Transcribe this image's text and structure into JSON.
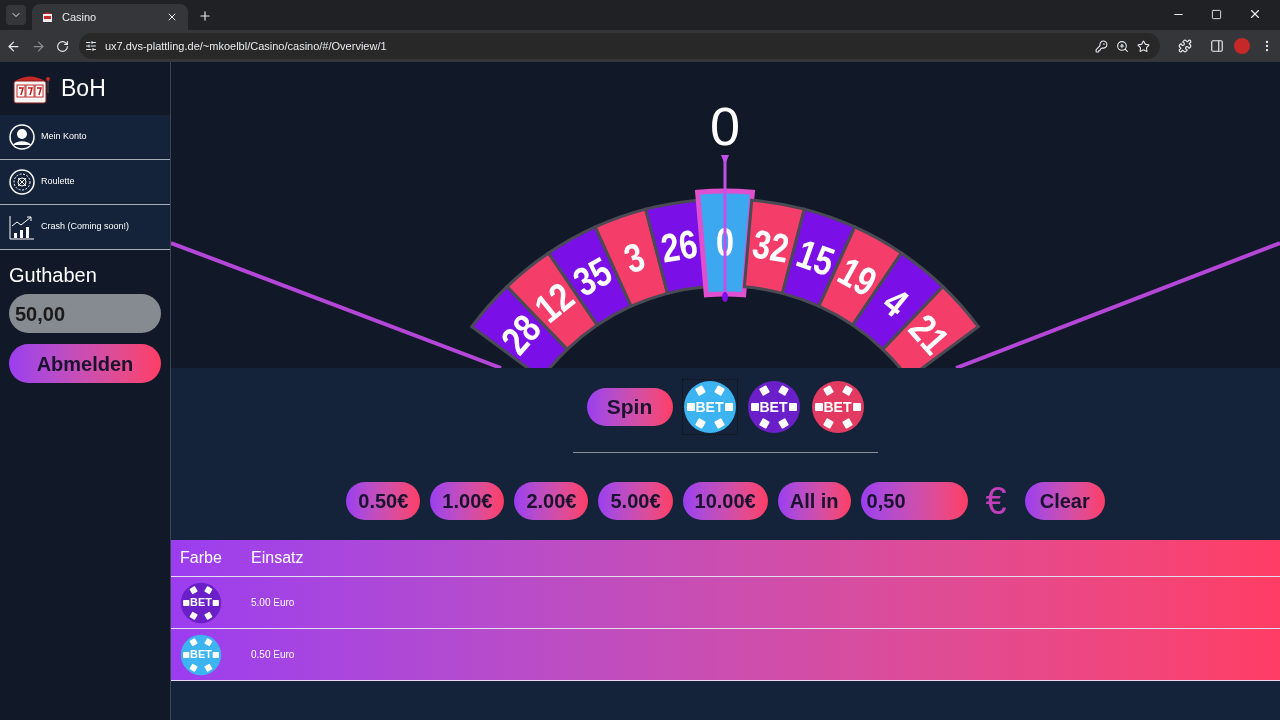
{
  "browser": {
    "tab_title": "Casino",
    "url": "ux7.dvs-plattling.de/~mkoelbl/Casino/casino/#/Overview/1"
  },
  "sidebar": {
    "brand": "BoH",
    "items": [
      {
        "label": "Mein Konto"
      },
      {
        "label": "Roulette"
      },
      {
        "label": "Crash (Coming soon!)"
      }
    ],
    "balance_label": "Guthaben",
    "balance": "50,00",
    "logout": "Abmelden"
  },
  "wheel": {
    "result": "0",
    "numbers": [
      {
        "label": "28",
        "color": "#7a0fe8",
        "selected": false
      },
      {
        "label": "12",
        "color": "#f43d68",
        "selected": false
      },
      {
        "label": "35",
        "color": "#7a0fe8",
        "selected": false
      },
      {
        "label": "3",
        "color": "#f43d68",
        "selected": false
      },
      {
        "label": "26",
        "color": "#7a0fe8",
        "selected": false
      },
      {
        "label": "0",
        "color": "#3ba8f0",
        "selected": true
      },
      {
        "label": "32",
        "color": "#f43d68",
        "selected": false
      },
      {
        "label": "15",
        "color": "#7a0fe8",
        "selected": false
      },
      {
        "label": "19",
        "color": "#f43d68",
        "selected": false
      },
      {
        "label": "4",
        "color": "#7a0fe8",
        "selected": false
      },
      {
        "label": "21",
        "color": "#f43d68",
        "selected": false
      }
    ]
  },
  "controls": {
    "spin": "Spin",
    "chips": [
      {
        "label": "BET",
        "color": "#3cb4f2",
        "selected": true
      },
      {
        "label": "BET",
        "color": "#6a1fc9",
        "selected": false
      },
      {
        "label": "BET",
        "color": "#e33a62",
        "selected": false
      }
    ],
    "amounts": [
      "0.50€",
      "1.00€",
      "2.00€",
      "5.00€",
      "10.00€",
      "All in"
    ],
    "amount_input": "0,50",
    "currency": "€",
    "clear": "Clear"
  },
  "bets_table": {
    "columns": [
      "Farbe",
      "Einsatz"
    ],
    "rows": [
      {
        "chip": {
          "label": "BET",
          "color": "#6a1fc9"
        },
        "amount": "5.00 Euro"
      },
      {
        "chip": {
          "label": "BET",
          "color": "#3cb4f2"
        },
        "amount": "0.50 Euro"
      }
    ]
  }
}
